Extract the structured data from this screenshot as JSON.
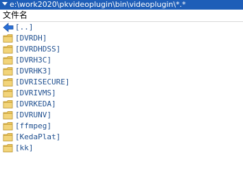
{
  "path_bar": {
    "path": "e:\\work2020\\pkvideoplugin\\bin\\videoplugin\\*.*"
  },
  "header": {
    "name_column": "文件名"
  },
  "files": [
    {
      "name": "[..]",
      "icon": "up-arrow-icon"
    },
    {
      "name": "[DVRDH]",
      "icon": "folder-icon"
    },
    {
      "name": "[DVRDHDSS]",
      "icon": "folder-icon"
    },
    {
      "name": "[DVRH3C]",
      "icon": "folder-icon"
    },
    {
      "name": "[DVRHK3]",
      "icon": "folder-icon"
    },
    {
      "name": "[DVRISECURE]",
      "icon": "folder-icon"
    },
    {
      "name": "[DVRIVMS]",
      "icon": "folder-icon"
    },
    {
      "name": "[DVRKEDA]",
      "icon": "folder-icon"
    },
    {
      "name": "[DVRUNV]",
      "icon": "folder-icon"
    },
    {
      "name": "[ffmpeg]",
      "icon": "folder-icon"
    },
    {
      "name": "[KedaPlat]",
      "icon": "folder-icon"
    },
    {
      "name": "[kk]",
      "icon": "folder-icon"
    }
  ],
  "colors": {
    "path_bar_bg": "#1e5eb8",
    "folder_fill": "#e8c25a",
    "folder_edge": "#b8902a",
    "up_arrow": "#2a6fd6",
    "file_text": "#1f4f8f"
  }
}
